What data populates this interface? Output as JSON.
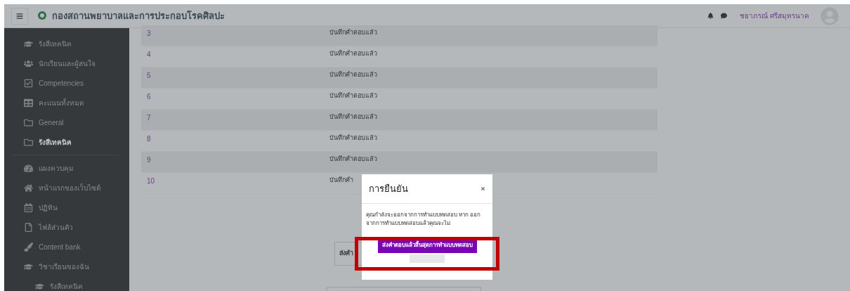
{
  "header": {
    "title": "กองสถานพยาบาลและการประกอบโรคศิลปะ",
    "user_name": "ชยาภรณ์ ศรีสมุทรนาค"
  },
  "sidebar": {
    "groups": [
      {
        "items": [
          {
            "label": "รังสีเทคนิค",
            "selected": false
          },
          {
            "label": "นักเรียนและผู้สนใจ",
            "selected": false
          },
          {
            "label": "Competencies",
            "selected": false
          },
          {
            "label": "คะแนนทั้งหมด",
            "selected": false
          },
          {
            "label": "General",
            "selected": false
          },
          {
            "label": "รังสีเทคนิค",
            "selected": true
          }
        ]
      },
      {
        "items": [
          {
            "label": "แผงควบคุม",
            "selected": false
          },
          {
            "label": "หน้าแรกของเว็บไซต์",
            "selected": false
          },
          {
            "label": "ปฏิทิน",
            "selected": false
          },
          {
            "label": "ไฟล์ส่วนตัว",
            "selected": false
          },
          {
            "label": "Content bank",
            "selected": false
          },
          {
            "label": "วิชาเรียนของฉัน",
            "selected": false,
            "children": [
              {
                "label": "รังสีเทคนิค",
                "selected": false
              }
            ]
          }
        ]
      }
    ]
  },
  "table": {
    "rows": [
      {
        "question": "3",
        "status": "บันทึกคำตอบแล้ว"
      },
      {
        "question": "4",
        "status": "บันทึกคำตอบแล้ว"
      },
      {
        "question": "5",
        "status": "บันทึกคำตอบแล้ว"
      },
      {
        "question": "6",
        "status": "บันทึกคำตอบแล้ว"
      },
      {
        "question": "7",
        "status": "บันทึกคำตอบแล้ว"
      },
      {
        "question": "8",
        "status": "บันทึกคำตอบแล้ว"
      },
      {
        "question": "9",
        "status": "บันทึกคำตอบแล้ว"
      },
      {
        "question": "10",
        "status": "บันทึกคำ"
      }
    ]
  },
  "submit_button_behind": "ส่งคำ",
  "dialog": {
    "title": "การยืนยัน",
    "message": "คุณกำลังจะออกจากการทำแบบทดสอบ หาก ออกจากการทำแบบทดสอบแล้วคุณจะไม่",
    "confirm_button": "ส่งคำตอบแล้วสิ้นสุดการทำแบบทดสอบ",
    "confirm_highlighted": true
  }
}
